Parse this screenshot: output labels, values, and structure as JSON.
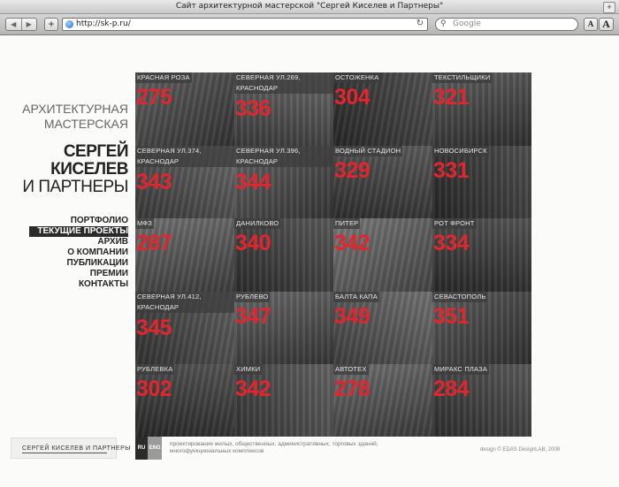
{
  "browser": {
    "window_title": "Сайт архитектурной мастерской \"Сергей Киселев и Партнеры\"",
    "url": "http://sk-p.ru/",
    "search_placeholder": "Google",
    "font_small_label": "A",
    "font_large_label": "A"
  },
  "site": {
    "tagline_line1": "АРХИТЕКТУРНАЯ",
    "tagline_line2": "МАСТЕРСКАЯ",
    "firm_line1": "СЕРГЕЙ",
    "firm_line2": "КИСЕЛЕВ",
    "firm_line3": "И ПАРТНЕРЫ",
    "menu": [
      "ПОРТФОЛИО",
      "ТЕКУЩИЕ ПРОЕКТЫ",
      "АРХИВ",
      "О КОМПАНИИ",
      "ПУБЛИКАЦИИ",
      "ПРЕМИИ",
      "КОНТАКТЫ"
    ],
    "menu_active_index": 1,
    "footer_logo_text": "СЕРГЕЙ КИСЕЛЕВ И ПАРТНЕРЫ",
    "lang_ru": "RU",
    "lang_eng": "ENG",
    "description": "проектирование жилых, общественных, административных, торговых зданий, многофункциональных комплексов",
    "credit": "design © EDAS DesignLAB, 2008"
  },
  "colors": {
    "accent_red": "#e3262d",
    "menu_active_bg": "#2b2b2b"
  },
  "projects": [
    {
      "label": "КРАСНАЯ РОЗА",
      "number": "275",
      "tone": "#4e4e4e"
    },
    {
      "label": "СЕВЕРНАЯ УЛ.269, КРАСНОДАР",
      "number": "336",
      "tone": "#5a5a5a"
    },
    {
      "label": "ОСТОЖЕНКА",
      "number": "304",
      "tone": "#3c3c3c"
    },
    {
      "label": "ТЕКСТИЛЬЩИКИ",
      "number": "321",
      "tone": "#4a4a4a"
    },
    {
      "label": "СЕВЕРНАЯ УЛ.374, КРАСНОДАР",
      "number": "343",
      "tone": "#585858"
    },
    {
      "label": "СЕВЕРНАЯ УЛ.396, КРАСНОДАР",
      "number": "344",
      "tone": "#525252"
    },
    {
      "label": "ВОДНЫЙ СТАДИОН",
      "number": "329",
      "tone": "#474747"
    },
    {
      "label": "НОВОСИБИРСК",
      "number": "331",
      "tone": "#3a3a3a"
    },
    {
      "label": "МФЗ",
      "number": "287",
      "tone": "#5f5f5f"
    },
    {
      "label": "ДАНИЛКОВО",
      "number": "340",
      "tone": "#444444"
    },
    {
      "label": "ПИТЕР",
      "number": "342",
      "tone": "#6a6a6a"
    },
    {
      "label": "РОТ ФРОНТ",
      "number": "334",
      "tone": "#3e3e3e"
    },
    {
      "label": "СЕВЕРНАЯ УЛ.412, КРАСНОДАР",
      "number": "345",
      "tone": "#4d4d4d"
    },
    {
      "label": "РУБЛЕВО",
      "number": "347",
      "tone": "#545454"
    },
    {
      "label": "БАЛТА КАПА",
      "number": "349",
      "tone": "#606060"
    },
    {
      "label": "СЕВАСТОПОЛЬ",
      "number": "351",
      "tone": "#4a4a4a"
    },
    {
      "label": "РУБЛЕВКА",
      "number": "302",
      "tone": "#3f3f3f"
    },
    {
      "label": "ХИМКИ",
      "number": "342",
      "tone": "#505050"
    },
    {
      "label": "АВТОТЕХ",
      "number": "278",
      "tone": "#5c5c5c"
    },
    {
      "label": "МИРАКС ПЛАЗА",
      "number": "284",
      "tone": "#464646"
    }
  ]
}
